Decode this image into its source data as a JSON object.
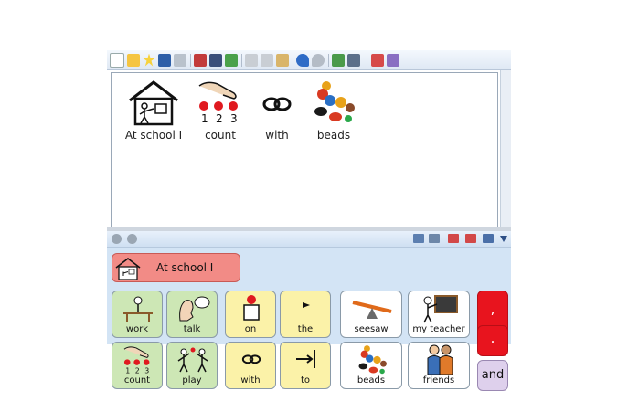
{
  "editor": {
    "symbols": [
      {
        "label": "At school I",
        "icon": "house-person-icon"
      },
      {
        "label": "count",
        "icon": "counting-hand-icon"
      },
      {
        "label": "with",
        "icon": "with-rings-icon"
      },
      {
        "label": "beads",
        "icon": "beads-icon"
      }
    ]
  },
  "grid": {
    "sentence_button": {
      "label": "At school I",
      "icon": "house-person-icon"
    },
    "cells": {
      "work": "work",
      "talk": "talk",
      "on": "on",
      "the": "the",
      "seesaw": "seesaw",
      "my_teacher": "my teacher",
      "comma": ",",
      "count": "count",
      "play": "play",
      "with": "with",
      "to": "to",
      "beads": "beads",
      "friends": "friends",
      "period": ".",
      "and": "and"
    }
  },
  "colors": {
    "green_cell": "#cde7b5",
    "yellow_cell": "#fbf2a8",
    "sentence_red": "#f28b86",
    "punct_red": "#e8141e",
    "purple_cell": "#ded0ec",
    "grid_background": "#d3e4f5"
  }
}
